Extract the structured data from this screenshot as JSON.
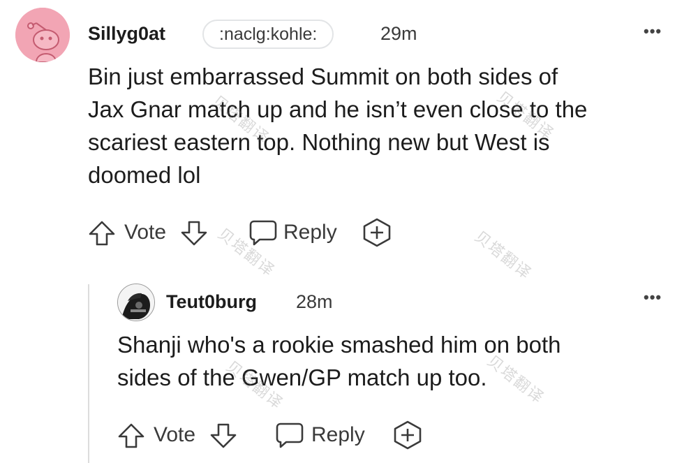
{
  "comment": {
    "username": "Sillyg0at",
    "flair": ":naclg:kohle:",
    "time": "29m",
    "text": "Bin just embarrassed Summit on both sides of\nJax Gnar match up and he isn’t even close to the\nscariest eastern top. Nothing new but West is\ndoomed lol",
    "actions": {
      "vote_label": "Vote",
      "reply_label": "Reply"
    },
    "more_label": "•••"
  },
  "reply": {
    "username": "Teut0burg",
    "time": "28m",
    "text": "Shanji who's a rookie smashed him on both\nsides of the Gwen/GP match up too.",
    "actions": {
      "vote_label": "Vote",
      "reply_label": "Reply"
    },
    "more_label": "•••"
  },
  "watermark": "贝塔翻译",
  "colors": {
    "avatar_bg": "#f2a5b4",
    "text": "#1c1c1c",
    "muted": "#3a3a3a",
    "thread_line": "#dcdcdc"
  }
}
